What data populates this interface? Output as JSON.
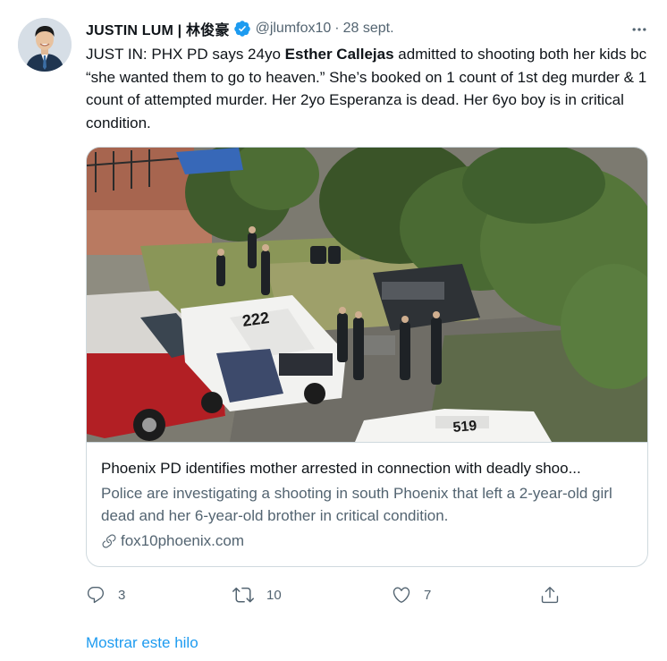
{
  "author": {
    "display_name": "JUSTIN LUM | 林俊豪",
    "handle": "@jlumfox10",
    "separator": "·",
    "date": "28 sept.",
    "verified": true
  },
  "tweet": {
    "text_parts": {
      "p1": "JUST IN: PHX PD says 24yo ",
      "bold": "Esther Callejas",
      "p2": " admitted to shooting both her kids bc “she wanted them to go to heaven.” She’s booked on 1 count of 1st deg murder & 1 count of attempted murder. Her 2yo Esperanza is dead. Her 6yo boy is in critical condition."
    }
  },
  "card": {
    "title": "Phoenix PD identifies mother arrested in connection with deadly shoo...",
    "description": "Police are investigating a shooting in south Phoenix that left a 2-year-old girl dead and her 6-year-old brother in critical condition.",
    "domain": "fox10phoenix.com",
    "image_text": {
      "unit_number_1": "222",
      "unit_number_2": "519"
    }
  },
  "actions": {
    "reply_count": "3",
    "retweet_count": "10",
    "like_count": "7"
  },
  "show_thread_label": "Mostrar este hilo",
  "colors": {
    "accent": "#1d9bf0",
    "secondary_text": "#536471",
    "border": "#cfd9de"
  },
  "icons": [
    "verified-badge-icon",
    "more-icon",
    "link-icon",
    "reply-icon",
    "retweet-icon",
    "like-icon",
    "share-icon"
  ]
}
